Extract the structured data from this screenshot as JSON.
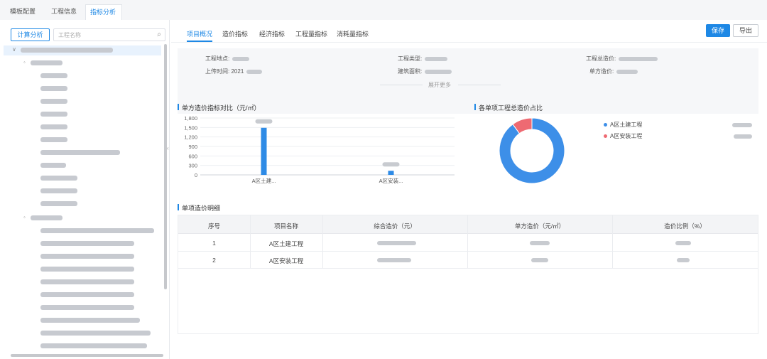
{
  "top_tabs": [
    {
      "label": "模板配置",
      "active": false
    },
    {
      "label": "工程信息",
      "active": false
    },
    {
      "label": "指标分析",
      "active": true
    }
  ],
  "left_panel": {
    "calc_button": "计算分析",
    "search_placeholder": "工程名称"
  },
  "sub_tabs": [
    {
      "label": "项目概况",
      "active": true
    },
    {
      "label": "造价指标",
      "active": false
    },
    {
      "label": "经济指标",
      "active": false
    },
    {
      "label": "工程量指标",
      "active": false
    },
    {
      "label": "消耗量指标",
      "active": false
    }
  ],
  "actions": {
    "save": "保存",
    "export": "导出"
  },
  "info": {
    "location_label": "工程地点:",
    "type_label": "工程类型:",
    "total_cost_label": "工程总造价:",
    "upload_time_label": "上传时间:",
    "upload_time_value": "2021",
    "area_label": "建筑面积:",
    "unit_cost_label": "单方造价:",
    "expand_label": "展开更多"
  },
  "bar_section_title": "单方造价指标对比（元/㎡）",
  "pie_section_title": "各单项工程总造价占比",
  "table_section_title": "单项造价明细",
  "chart_data": [
    {
      "type": "bar",
      "categories": [
        "A区土建...",
        "A区安装..."
      ],
      "values": [
        1490,
        130
      ],
      "ylim": [
        0,
        1800
      ],
      "yticks": [
        "1,800",
        "1,500",
        "1,200",
        "900",
        "600",
        "300",
        "0"
      ],
      "color": "#2e8be6"
    },
    {
      "type": "pie",
      "donut": true,
      "labels": [
        "A区土建工程",
        "A区安装工程"
      ],
      "values": [
        90,
        10
      ],
      "colors": [
        "#3d8fe8",
        "#ee6a72"
      ]
    }
  ],
  "table": {
    "headers": [
      "序号",
      "项目名称",
      "综合造价（元）",
      "单方造价（元/㎡）",
      "造价比例（%）"
    ],
    "rows": [
      {
        "index": "1",
        "name": "A区土建工程"
      },
      {
        "index": "2",
        "name": "A区安装工程"
      }
    ]
  }
}
